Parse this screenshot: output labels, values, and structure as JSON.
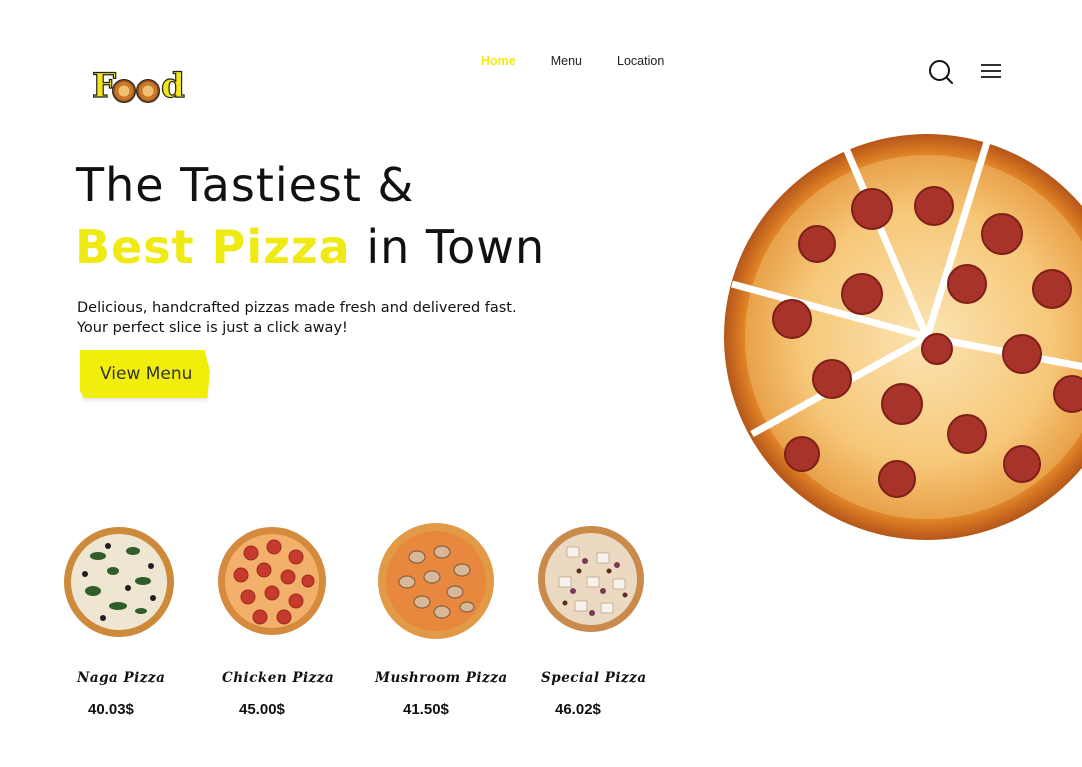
{
  "brand": {
    "logo_text": "Food"
  },
  "nav": {
    "items": [
      {
        "label": "Home",
        "active": true
      },
      {
        "label": "Menu",
        "active": false
      },
      {
        "label": "Location",
        "active": false
      }
    ],
    "accent_color": "#f0ea14"
  },
  "header_icons": [
    "search-icon",
    "hamburger-menu-icon"
  ],
  "hero": {
    "line1": "The Tastiest &",
    "line2_accent": "Best Pizza",
    "line2_rest": " in Town",
    "description_line1": "Delicious, handcrafted pizzas made fresh and delivered fast.",
    "description_line2": "Your perfect slice is just a click away!",
    "cta_label": "View Menu"
  },
  "products": [
    {
      "name": "Naga Pizza",
      "price": "40.03$"
    },
    {
      "name": "Chicken Pizza",
      "price": "45.00$"
    },
    {
      "name": "Mushroom Pizza",
      "price": "41.50$"
    },
    {
      "name": "Special Pizza",
      "price": "46.02$"
    }
  ]
}
